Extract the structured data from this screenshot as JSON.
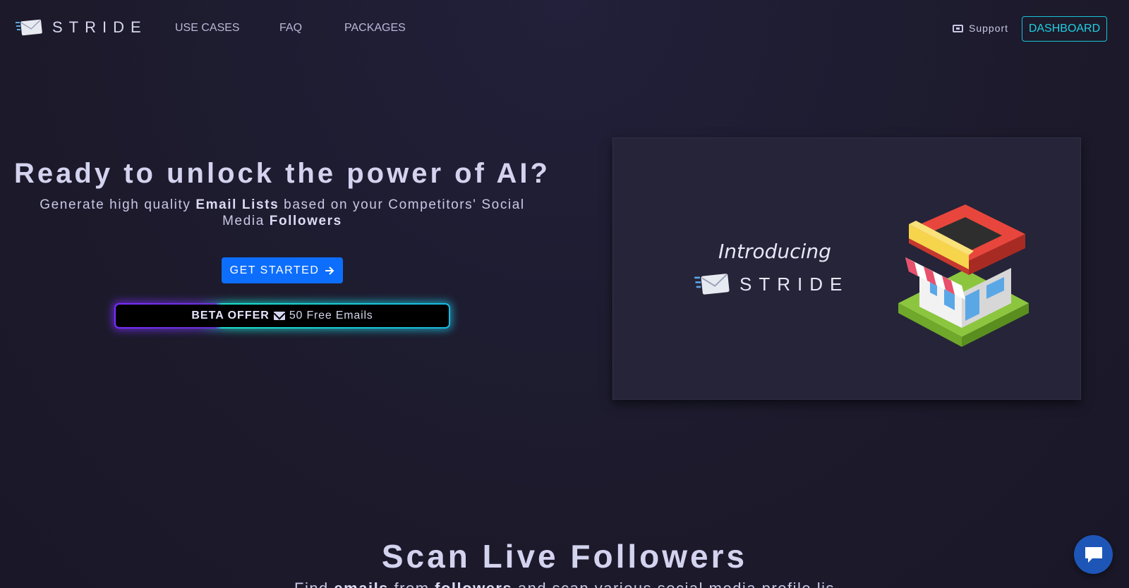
{
  "nav": {
    "brand": "STRIDE",
    "links": [
      "USE CASES",
      "FAQ",
      "PACKAGES"
    ],
    "support_label": "Support",
    "dashboard_label": "DASHBOARD"
  },
  "hero": {
    "title": "Ready to unlock the power of AI?",
    "subtitle_parts": [
      "Generate high quality ",
      "Email Lists",
      " based on your Competitors' Social Media ",
      "Followers"
    ],
    "cta_label": "GET STARTED",
    "beta_strong": "BETA OFFER",
    "beta_text": "50 Free Emails"
  },
  "video": {
    "intro_text": "Introducing",
    "brand": "STRIDE"
  },
  "section": {
    "title": "Scan Live Followers",
    "subtitle_parts": [
      "Find ",
      "emails",
      " from ",
      "followers",
      " and scan various social media profile lis"
    ]
  },
  "colors": {
    "accent": "#0d6efd",
    "dashboard_border": "#17c3d4",
    "background": "#1c1a2b"
  },
  "icons": [
    "envelope-logo-icon",
    "ticket-icon",
    "arrow-right-icon",
    "envelope-icon",
    "storefront-illustration",
    "chat-icon"
  ]
}
